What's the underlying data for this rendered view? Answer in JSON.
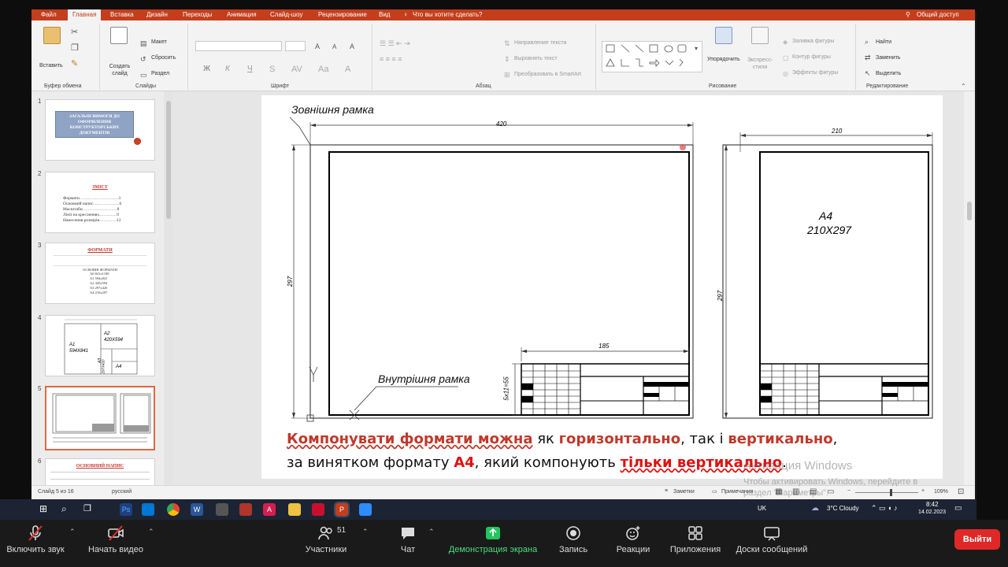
{
  "ribbon": {
    "tabs": [
      "Файл",
      "Главная",
      "Вставка",
      "Дизайн",
      "Переходы",
      "Анимация",
      "Слайд-шоу",
      "Рецензирование",
      "Вид"
    ],
    "tell_me": "Что вы хотите сделать?",
    "share": "Общий доступ",
    "clipboard": {
      "paste": "Вставить",
      "label": "Буфер обмена"
    },
    "slides": {
      "new_slide": "Создать слайд",
      "layout": "Макет",
      "reset": "Сбросить",
      "section": "Раздел",
      "label": "Слайды"
    },
    "font": {
      "bold": "Ж",
      "italic": "К",
      "underline": "Ч",
      "label": "Шрифт"
    },
    "paragraph": {
      "text_direction": "Направление текста",
      "align_text": "Выровнять текст",
      "smartart": "Преобразовать в SmartArt",
      "label": "Абзац"
    },
    "drawing": {
      "arrange": "Упорядочить",
      "quick_styles": "Экспресс-стили",
      "fill": "Заливка фигуры",
      "outline": "Контур фигуры",
      "effects": "Эффекты фигуры",
      "label": "Рисование"
    },
    "editing": {
      "find": "Найти",
      "replace": "Заменить",
      "select": "Выделить",
      "label": "Редактирование"
    }
  },
  "thumbnails": {
    "numbers": [
      "1",
      "2",
      "3",
      "4",
      "5",
      "6"
    ],
    "s1_title": "ЗАГАЛЬНІ ВИМОГИ ДО ОФОРМЛЕННЯ КОНСТРУКТОРСЬКИХ ДОКУМЕНТІВ",
    "s2_title": "ЗМІСТ",
    "s2_items": [
      "Формати………………………3",
      "Основний напис………………6",
      "Масштаби……………………8",
      "Лінії на кресленнях…………9",
      "Нанесення розмірів…………12"
    ],
    "s3_title": "ФОРМАТИ",
    "s3_sub": "ОСНОВНІ ФОРМАТИ",
    "s3_rows": [
      "А0  841х1189",
      "А1  594х841",
      "А2  420х594",
      "А3  297х420",
      "А4  210х297"
    ],
    "s4_labels": [
      "А1",
      "594Х841",
      "А2",
      "420Х594",
      "А3",
      "297Х420",
      "А4"
    ],
    "s6_title": "ОСНОВНИЙ НАПИС"
  },
  "slide": {
    "outer_frame": "Зовнішня рамка",
    "inner_frame": "Внутрішня рамка",
    "dim_420": "420",
    "dim_297_left": "297",
    "dim_185": "185",
    "dim_5x11": "5х11=55",
    "dim_210": "210",
    "dim_297_right": "297",
    "a4_label": "А4",
    "a4_size": "210Х297",
    "caption": {
      "p1": "Компонувати формати можна",
      "p2": " як ",
      "p3": "горизонтально",
      "p4": ", так і ",
      "p5": "вертикально",
      "p6": ",",
      "p7": "за винятком формату ",
      "p8": "А4",
      "p9": ", який компонують ",
      "p10": "тільки вертикально",
      "p11": "."
    }
  },
  "status": {
    "slide": "Слайд 5 из 16",
    "language": "русский",
    "notes": "Заметки",
    "comments": "Примечания",
    "zoom": "109%"
  },
  "watermark": {
    "line1": "Активация Windows",
    "line2": "Чтобы активировать Windows, перейдите в",
    "line3": "раздел \"Параметры\"."
  },
  "taskbar": {
    "lang": "UK",
    "weather": "3°C  Cloudy",
    "time": "8:42",
    "date": "14.02.2023"
  },
  "zoom": {
    "mute": "Включить звук",
    "video": "Начать видео",
    "participants": "Участники",
    "participants_count": "51",
    "chat": "Чат",
    "share": "Демонстрация экрана",
    "record": "Запись",
    "reactions": "Реакции",
    "apps": "Приложения",
    "whiteboards": "Доски сообщений",
    "leave": "Выйти"
  },
  "colors": {
    "accent": "#c43e1c",
    "caption_red": "#c0392b",
    "share_green": "#22c55e",
    "leave_red": "#e02828"
  }
}
